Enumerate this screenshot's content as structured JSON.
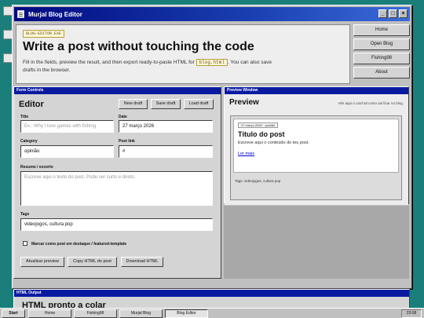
{
  "window": {
    "title": "Murjal Blog Editor",
    "controls": [
      "_",
      "□",
      "×"
    ]
  },
  "hero": {
    "tag": "BLOG-EDITOR.EXE",
    "title": "Write a post without touching the code",
    "desc_before": "Fill in the fields, preview the result, and then export ready-to-paste HTML for",
    "code": "blog.html",
    "desc_after": ". You can also save drafts in the browser."
  },
  "nav": [
    "Home",
    "Open Blog",
    "Fishing98",
    "About"
  ],
  "form": {
    "panel_label": "Form Controls",
    "heading": "Editor",
    "actions": [
      "New draft",
      "Save draft",
      "Load draft"
    ],
    "title_label": "Title",
    "title_placeholder": "Ex.: Why I love games with fishing",
    "date_label": "Date",
    "date_value": "27 março 2026",
    "category_label": "Category",
    "category_value": "opinião",
    "link_label": "Post link",
    "link_value": "#",
    "summary_label": "Resumo / excerto",
    "summary_placeholder": "Escreve aqui o texto do post. Pode ser curto e direto.",
    "tags_label": "Tags",
    "tags_value": "videojogos, cultura pop",
    "featured_label": "Marcar como post em destaque / featured-template",
    "footer_actions": [
      "Atualizar preview",
      "Copy HTML do post",
      "Download HTML"
    ]
  },
  "preview": {
    "panel_label": "Preview Window",
    "heading": "Preview",
    "hint": "Vês aqui o card tal como vai ficar no blog.",
    "card_meta": "27 março 2026 · opinião",
    "card_title": "Título do post",
    "card_text": "Escreve aqui o conteúdo do teu post.",
    "card_link": "Ler mais",
    "card_tags": "Tags: videojogos, cultura pop"
  },
  "output": {
    "panel_label": "HTML Output",
    "heading": "HTML pronto a colar"
  },
  "taskbar": {
    "start": "Start",
    "items": [
      "Home",
      "Fishing98",
      "Murjal Blog",
      "Blog Editor"
    ],
    "clock": "23:08"
  },
  "colors": {
    "titlebar": "#0a1aa0",
    "desktop": "#1a7f7a",
    "link": "#0000cc"
  }
}
